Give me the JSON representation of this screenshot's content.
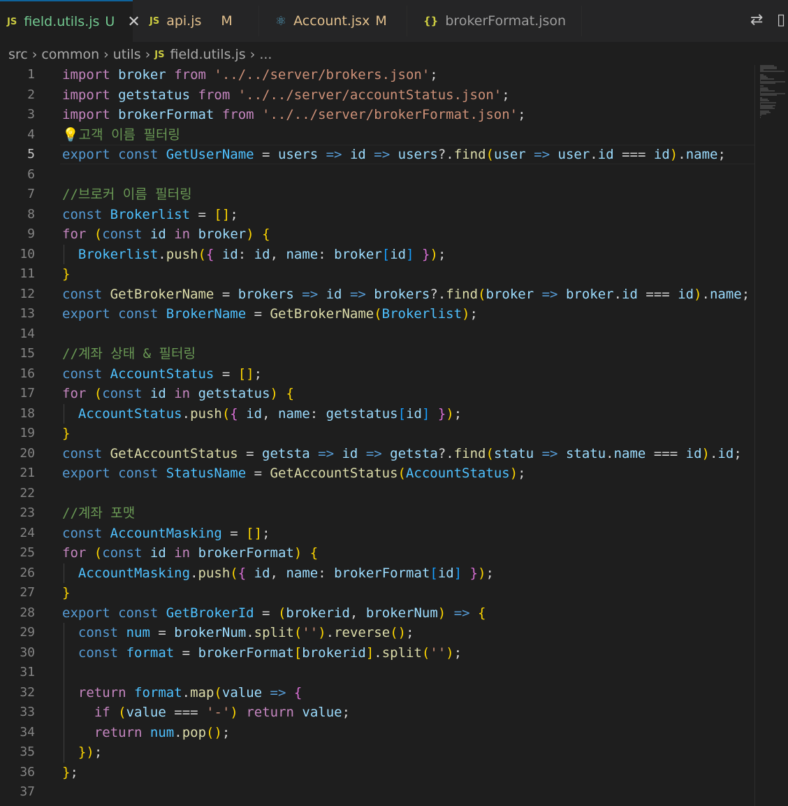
{
  "tabs": [
    {
      "icon": "JS",
      "label": "field.utils.js",
      "badge": "U",
      "active": true
    },
    {
      "icon": "JS",
      "label": "api.js",
      "badge": "M",
      "active": false
    },
    {
      "icon": "⚛",
      "label": "Account.jsx",
      "badge": "M",
      "active": false
    },
    {
      "icon": "{}",
      "label": "brokerFormat.json",
      "badge": "",
      "active": false
    }
  ],
  "breadcrumb": [
    "src",
    "common",
    "utils",
    "field.utils.js",
    "..."
  ],
  "breadcrumb_file_icon": "JS",
  "editor": {
    "current_line": 5,
    "lines": [
      "import broker from '../../server/brokers.json';",
      "import getstatus from '../../server/accountStatus.json';",
      "import brokerFormat from '../../server/brokerFormat.json';",
      "💡고객 이름 필터링",
      "export const GetUserName = users => id => users?.find(user => user.id === id).name;",
      "",
      "//브로커 이름 필터링",
      "const Brokerlist = [];",
      "for (const id in broker) {",
      "  Brokerlist.push({ id: id, name: broker[id] });",
      "}",
      "const GetBrokerName = brokers => id => brokers?.find(broker => broker.id === id).name;",
      "export const BrokerName = GetBrokerName(Brokerlist);",
      "",
      "//계좌 상태 & 필터링",
      "const AccountStatus = [];",
      "for (const id in getstatus) {",
      "  AccountStatus.push({ id, name: getstatus[id] });",
      "}",
      "const GetAccountStatus = getsta => id => getsta?.find(statu => statu.name === id).id;",
      "export const StatusName = GetAccountStatus(AccountStatus);",
      "",
      "//계좌 포맷",
      "const AccountMasking = [];",
      "for (const id in brokerFormat) {",
      "  AccountMasking.push({ id, name: brokerFormat[id] });",
      "}",
      "export const GetBrokerId = (brokerid, brokerNum) => {",
      "  const num = brokerNum.split('').reverse();",
      "  const format = brokerFormat[brokerid].split('');",
      "",
      "  return format.map(value => {",
      "    if (value === '-') return value;",
      "    return num.pop();",
      "  });",
      "};",
      ""
    ]
  },
  "colors": {
    "keyword": "#c586c0",
    "storage": "#569cd6",
    "variable": "#9cdcfe",
    "constant": "#4fc1ff",
    "function": "#dcdcaa",
    "string": "#ce9178",
    "comment": "#6a9955",
    "bracket1": "#ffd700",
    "bracket2": "#da70d6",
    "bracket3": "#179fff"
  },
  "icons": [
    "js-file-icon",
    "react-file-icon",
    "json-file-icon",
    "close-icon",
    "compare-changes-icon",
    "split-editor-icon",
    "lightbulb-icon",
    "chevron-right-icon"
  ]
}
